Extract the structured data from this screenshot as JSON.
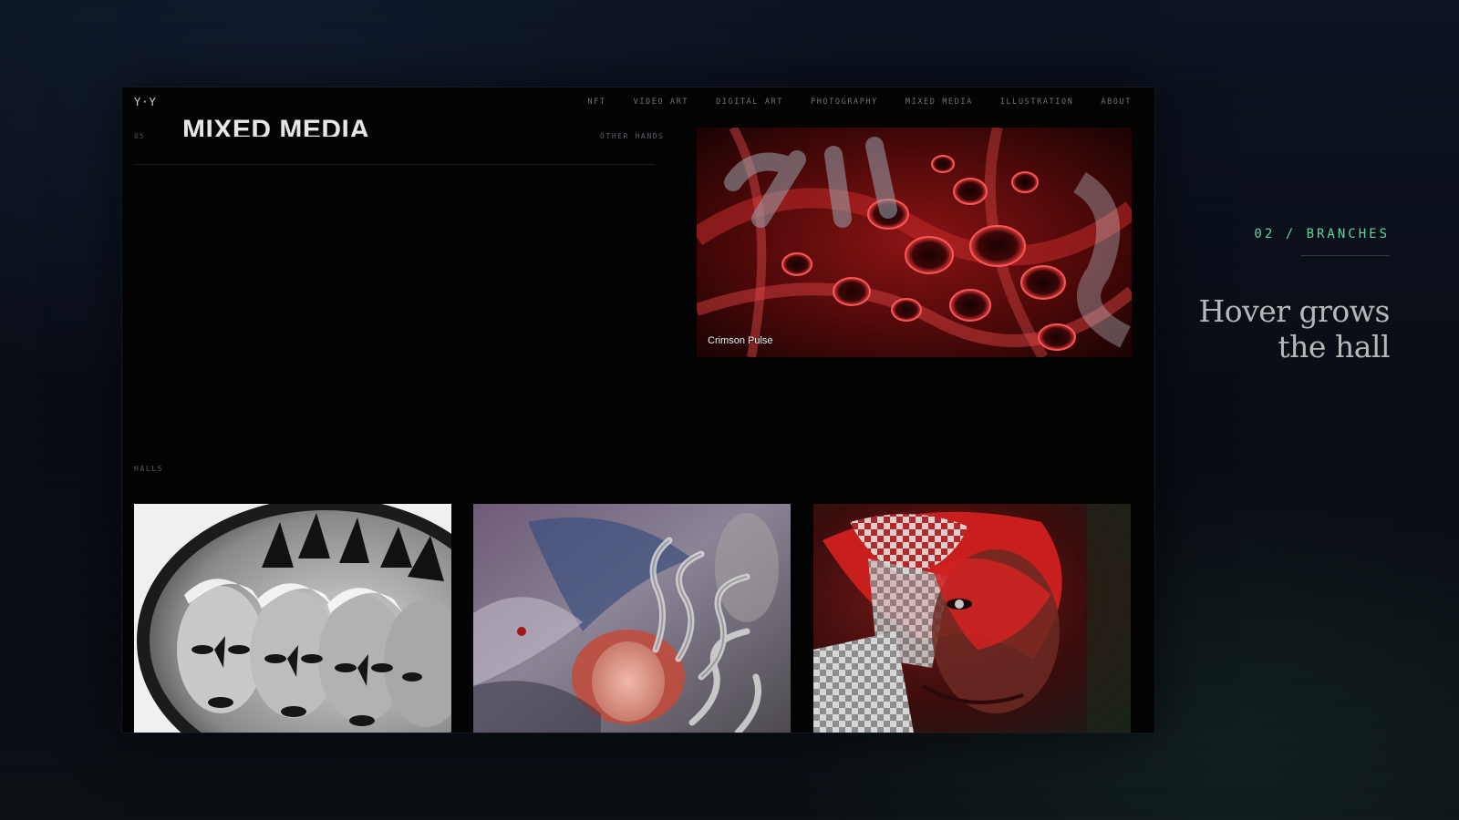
{
  "app": {
    "logo": "Y·Y",
    "nav": [
      {
        "label": "NFT"
      },
      {
        "label": "VIDEO ART"
      },
      {
        "label": "DIGITAL ART"
      },
      {
        "label": "PHOTOGRAPHY"
      },
      {
        "label": "MIXED MEDIA"
      },
      {
        "label": "ILLUSTRATION"
      },
      {
        "label": "ABOUT"
      }
    ]
  },
  "section": {
    "number": "05",
    "title": "MIXED MEDIA",
    "aside": "OTHER HANDS"
  },
  "featured": {
    "caption": "Crimson Pulse"
  },
  "halls": {
    "label": "HALLS"
  },
  "annotation": {
    "tag": "02 / BRANCHES",
    "headline_line1": "Hover grows",
    "headline_line2": "the hall",
    "accent_color": "#5fd69a"
  }
}
